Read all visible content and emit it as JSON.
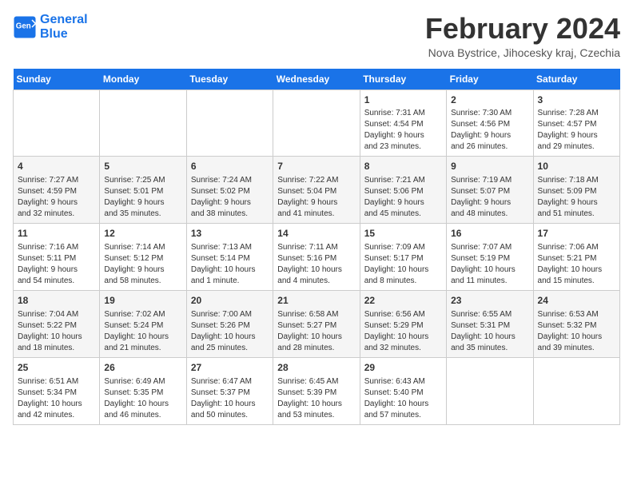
{
  "header": {
    "logo_line1": "General",
    "logo_line2": "Blue",
    "title": "February 2024",
    "subtitle": "Nova Bystrice, Jihocesky kraj, Czechia"
  },
  "days_of_week": [
    "Sunday",
    "Monday",
    "Tuesday",
    "Wednesday",
    "Thursday",
    "Friday",
    "Saturday"
  ],
  "weeks": [
    [
      {
        "day": "",
        "info": ""
      },
      {
        "day": "",
        "info": ""
      },
      {
        "day": "",
        "info": ""
      },
      {
        "day": "",
        "info": ""
      },
      {
        "day": "1",
        "info": "Sunrise: 7:31 AM\nSunset: 4:54 PM\nDaylight: 9 hours\nand 23 minutes."
      },
      {
        "day": "2",
        "info": "Sunrise: 7:30 AM\nSunset: 4:56 PM\nDaylight: 9 hours\nand 26 minutes."
      },
      {
        "day": "3",
        "info": "Sunrise: 7:28 AM\nSunset: 4:57 PM\nDaylight: 9 hours\nand 29 minutes."
      }
    ],
    [
      {
        "day": "4",
        "info": "Sunrise: 7:27 AM\nSunset: 4:59 PM\nDaylight: 9 hours\nand 32 minutes."
      },
      {
        "day": "5",
        "info": "Sunrise: 7:25 AM\nSunset: 5:01 PM\nDaylight: 9 hours\nand 35 minutes."
      },
      {
        "day": "6",
        "info": "Sunrise: 7:24 AM\nSunset: 5:02 PM\nDaylight: 9 hours\nand 38 minutes."
      },
      {
        "day": "7",
        "info": "Sunrise: 7:22 AM\nSunset: 5:04 PM\nDaylight: 9 hours\nand 41 minutes."
      },
      {
        "day": "8",
        "info": "Sunrise: 7:21 AM\nSunset: 5:06 PM\nDaylight: 9 hours\nand 45 minutes."
      },
      {
        "day": "9",
        "info": "Sunrise: 7:19 AM\nSunset: 5:07 PM\nDaylight: 9 hours\nand 48 minutes."
      },
      {
        "day": "10",
        "info": "Sunrise: 7:18 AM\nSunset: 5:09 PM\nDaylight: 9 hours\nand 51 minutes."
      }
    ],
    [
      {
        "day": "11",
        "info": "Sunrise: 7:16 AM\nSunset: 5:11 PM\nDaylight: 9 hours\nand 54 minutes."
      },
      {
        "day": "12",
        "info": "Sunrise: 7:14 AM\nSunset: 5:12 PM\nDaylight: 9 hours\nand 58 minutes."
      },
      {
        "day": "13",
        "info": "Sunrise: 7:13 AM\nSunset: 5:14 PM\nDaylight: 10 hours\nand 1 minute."
      },
      {
        "day": "14",
        "info": "Sunrise: 7:11 AM\nSunset: 5:16 PM\nDaylight: 10 hours\nand 4 minutes."
      },
      {
        "day": "15",
        "info": "Sunrise: 7:09 AM\nSunset: 5:17 PM\nDaylight: 10 hours\nand 8 minutes."
      },
      {
        "day": "16",
        "info": "Sunrise: 7:07 AM\nSunset: 5:19 PM\nDaylight: 10 hours\nand 11 minutes."
      },
      {
        "day": "17",
        "info": "Sunrise: 7:06 AM\nSunset: 5:21 PM\nDaylight: 10 hours\nand 15 minutes."
      }
    ],
    [
      {
        "day": "18",
        "info": "Sunrise: 7:04 AM\nSunset: 5:22 PM\nDaylight: 10 hours\nand 18 minutes."
      },
      {
        "day": "19",
        "info": "Sunrise: 7:02 AM\nSunset: 5:24 PM\nDaylight: 10 hours\nand 21 minutes."
      },
      {
        "day": "20",
        "info": "Sunrise: 7:00 AM\nSunset: 5:26 PM\nDaylight: 10 hours\nand 25 minutes."
      },
      {
        "day": "21",
        "info": "Sunrise: 6:58 AM\nSunset: 5:27 PM\nDaylight: 10 hours\nand 28 minutes."
      },
      {
        "day": "22",
        "info": "Sunrise: 6:56 AM\nSunset: 5:29 PM\nDaylight: 10 hours\nand 32 minutes."
      },
      {
        "day": "23",
        "info": "Sunrise: 6:55 AM\nSunset: 5:31 PM\nDaylight: 10 hours\nand 35 minutes."
      },
      {
        "day": "24",
        "info": "Sunrise: 6:53 AM\nSunset: 5:32 PM\nDaylight: 10 hours\nand 39 minutes."
      }
    ],
    [
      {
        "day": "25",
        "info": "Sunrise: 6:51 AM\nSunset: 5:34 PM\nDaylight: 10 hours\nand 42 minutes."
      },
      {
        "day": "26",
        "info": "Sunrise: 6:49 AM\nSunset: 5:35 PM\nDaylight: 10 hours\nand 46 minutes."
      },
      {
        "day": "27",
        "info": "Sunrise: 6:47 AM\nSunset: 5:37 PM\nDaylight: 10 hours\nand 50 minutes."
      },
      {
        "day": "28",
        "info": "Sunrise: 6:45 AM\nSunset: 5:39 PM\nDaylight: 10 hours\nand 53 minutes."
      },
      {
        "day": "29",
        "info": "Sunrise: 6:43 AM\nSunset: 5:40 PM\nDaylight: 10 hours\nand 57 minutes."
      },
      {
        "day": "",
        "info": ""
      },
      {
        "day": "",
        "info": ""
      }
    ]
  ]
}
